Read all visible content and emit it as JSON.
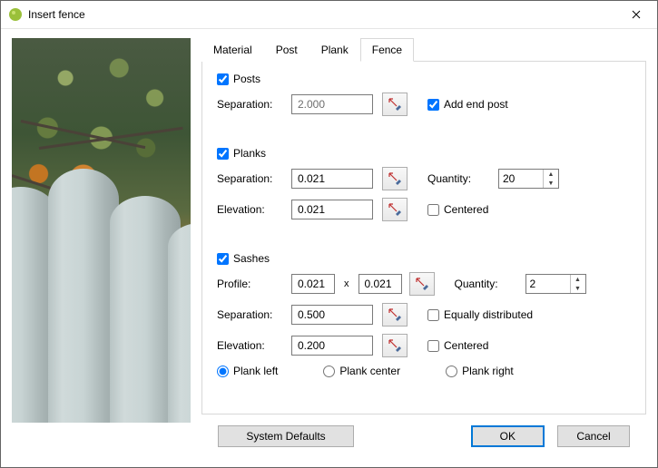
{
  "window": {
    "title": "Insert fence"
  },
  "tabs": [
    "Material",
    "Post",
    "Plank",
    "Fence"
  ],
  "activeTab": 3,
  "posts": {
    "enabled_label": "Posts",
    "enabled": true,
    "separation_label": "Separation:",
    "separation": "2.000",
    "add_end_post_label": "Add end post",
    "add_end_post": true
  },
  "planks": {
    "enabled_label": "Planks",
    "enabled": true,
    "separation_label": "Separation:",
    "separation": "0.021",
    "elevation_label": "Elevation:",
    "elevation": "0.021",
    "quantity_label": "Quantity:",
    "quantity": "20",
    "centered_label": "Centered",
    "centered": false
  },
  "sashes": {
    "enabled_label": "Sashes",
    "enabled": true,
    "profile_label": "Profile:",
    "profile_w": "0.021",
    "profile_h": "0.021",
    "separation_label": "Separation:",
    "separation": "0.500",
    "elevation_label": "Elevation:",
    "elevation": "0.200",
    "quantity_label": "Quantity:",
    "quantity": "2",
    "equally_label": "Equally distributed",
    "equally": false,
    "centered_label": "Centered",
    "centered": false,
    "align_options": {
      "left": "Plank left",
      "center": "Plank center",
      "right": "Plank right"
    },
    "align": "left"
  },
  "footer": {
    "defaults": "System Defaults",
    "ok": "OK",
    "cancel": "Cancel"
  },
  "x_symbol": "x"
}
